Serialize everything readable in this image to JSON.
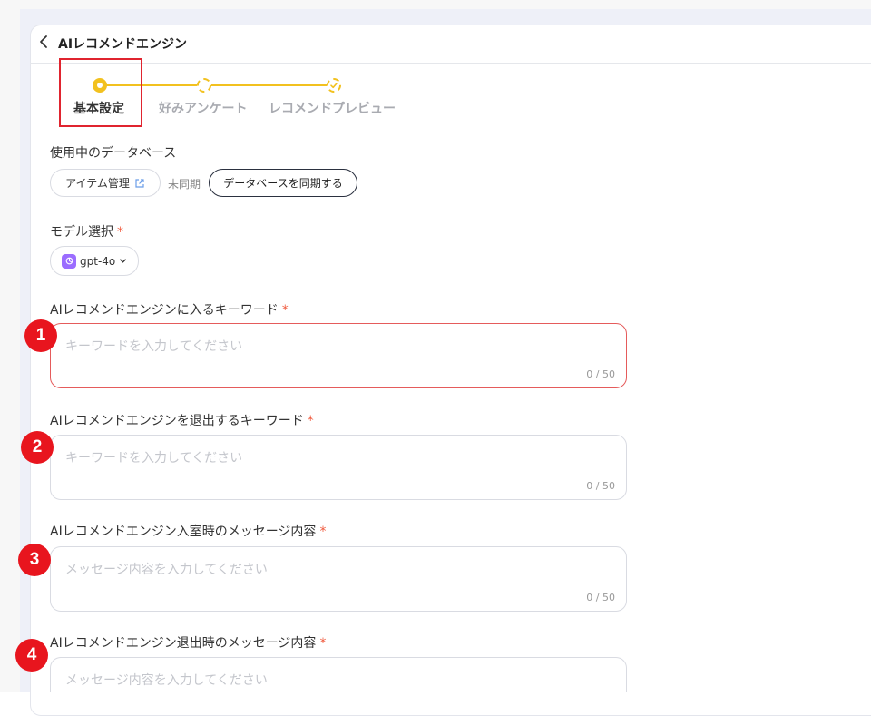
{
  "header": {
    "title": "AIレコメンドエンジン"
  },
  "stepper": {
    "steps": [
      {
        "label": "基本設定"
      },
      {
        "label": "好みアンケート"
      },
      {
        "label": "レコメンドプレビュー"
      }
    ],
    "accent_color": "#f2c11f"
  },
  "database": {
    "label": "使用中のデータベース",
    "item_button": "アイテム管理",
    "status": "未同期",
    "sync_button": "データベースを同期する"
  },
  "model": {
    "label": "モデル選択",
    "required": "*",
    "selected": "gpt-4o"
  },
  "fields": [
    {
      "label": "AIレコメンドエンジンに入るキーワード",
      "required": "*",
      "placeholder": "キーワードを入力してください",
      "count": "0 / 50",
      "badge": "1"
    },
    {
      "label": "AIレコメンドエンジンを退出するキーワード",
      "required": "*",
      "placeholder": "キーワードを入力してください",
      "count": "0 / 50",
      "badge": "2"
    },
    {
      "label": "AIレコメンドエンジン入室時のメッセージ内容",
      "required": "*",
      "placeholder": "メッセージ内容を入力してください",
      "count": "0 / 50",
      "badge": "3"
    },
    {
      "label": "AIレコメンドエンジン退出時のメッセージ内容",
      "required": "*",
      "placeholder": "メッセージ内容を入力してください",
      "count": "",
      "badge": "4"
    }
  ]
}
